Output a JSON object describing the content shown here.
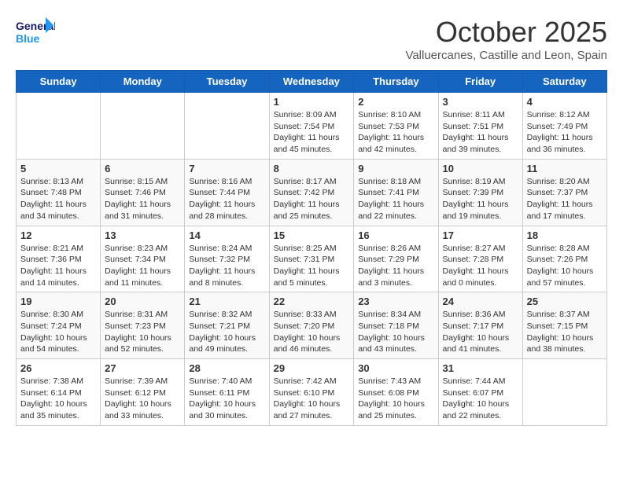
{
  "logo": {
    "line1": "General",
    "line2": "Blue"
  },
  "title": "October 2025",
  "subtitle": "Valluercanes, Castille and Leon, Spain",
  "weekdays": [
    "Sunday",
    "Monday",
    "Tuesday",
    "Wednesday",
    "Thursday",
    "Friday",
    "Saturday"
  ],
  "weeks": [
    [
      {
        "day": "",
        "info": ""
      },
      {
        "day": "",
        "info": ""
      },
      {
        "day": "",
        "info": ""
      },
      {
        "day": "1",
        "info": "Sunrise: 8:09 AM\nSunset: 7:54 PM\nDaylight: 11 hours and 45 minutes."
      },
      {
        "day": "2",
        "info": "Sunrise: 8:10 AM\nSunset: 7:53 PM\nDaylight: 11 hours and 42 minutes."
      },
      {
        "day": "3",
        "info": "Sunrise: 8:11 AM\nSunset: 7:51 PM\nDaylight: 11 hours and 39 minutes."
      },
      {
        "day": "4",
        "info": "Sunrise: 8:12 AM\nSunset: 7:49 PM\nDaylight: 11 hours and 36 minutes."
      }
    ],
    [
      {
        "day": "5",
        "info": "Sunrise: 8:13 AM\nSunset: 7:48 PM\nDaylight: 11 hours and 34 minutes."
      },
      {
        "day": "6",
        "info": "Sunrise: 8:15 AM\nSunset: 7:46 PM\nDaylight: 11 hours and 31 minutes."
      },
      {
        "day": "7",
        "info": "Sunrise: 8:16 AM\nSunset: 7:44 PM\nDaylight: 11 hours and 28 minutes."
      },
      {
        "day": "8",
        "info": "Sunrise: 8:17 AM\nSunset: 7:42 PM\nDaylight: 11 hours and 25 minutes."
      },
      {
        "day": "9",
        "info": "Sunrise: 8:18 AM\nSunset: 7:41 PM\nDaylight: 11 hours and 22 minutes."
      },
      {
        "day": "10",
        "info": "Sunrise: 8:19 AM\nSunset: 7:39 PM\nDaylight: 11 hours and 19 minutes."
      },
      {
        "day": "11",
        "info": "Sunrise: 8:20 AM\nSunset: 7:37 PM\nDaylight: 11 hours and 17 minutes."
      }
    ],
    [
      {
        "day": "12",
        "info": "Sunrise: 8:21 AM\nSunset: 7:36 PM\nDaylight: 11 hours and 14 minutes."
      },
      {
        "day": "13",
        "info": "Sunrise: 8:23 AM\nSunset: 7:34 PM\nDaylight: 11 hours and 11 minutes."
      },
      {
        "day": "14",
        "info": "Sunrise: 8:24 AM\nSunset: 7:32 PM\nDaylight: 11 hours and 8 minutes."
      },
      {
        "day": "15",
        "info": "Sunrise: 8:25 AM\nSunset: 7:31 PM\nDaylight: 11 hours and 5 minutes."
      },
      {
        "day": "16",
        "info": "Sunrise: 8:26 AM\nSunset: 7:29 PM\nDaylight: 11 hours and 3 minutes."
      },
      {
        "day": "17",
        "info": "Sunrise: 8:27 AM\nSunset: 7:28 PM\nDaylight: 11 hours and 0 minutes."
      },
      {
        "day": "18",
        "info": "Sunrise: 8:28 AM\nSunset: 7:26 PM\nDaylight: 10 hours and 57 minutes."
      }
    ],
    [
      {
        "day": "19",
        "info": "Sunrise: 8:30 AM\nSunset: 7:24 PM\nDaylight: 10 hours and 54 minutes."
      },
      {
        "day": "20",
        "info": "Sunrise: 8:31 AM\nSunset: 7:23 PM\nDaylight: 10 hours and 52 minutes."
      },
      {
        "day": "21",
        "info": "Sunrise: 8:32 AM\nSunset: 7:21 PM\nDaylight: 10 hours and 49 minutes."
      },
      {
        "day": "22",
        "info": "Sunrise: 8:33 AM\nSunset: 7:20 PM\nDaylight: 10 hours and 46 minutes."
      },
      {
        "day": "23",
        "info": "Sunrise: 8:34 AM\nSunset: 7:18 PM\nDaylight: 10 hours and 43 minutes."
      },
      {
        "day": "24",
        "info": "Sunrise: 8:36 AM\nSunset: 7:17 PM\nDaylight: 10 hours and 41 minutes."
      },
      {
        "day": "25",
        "info": "Sunrise: 8:37 AM\nSunset: 7:15 PM\nDaylight: 10 hours and 38 minutes."
      }
    ],
    [
      {
        "day": "26",
        "info": "Sunrise: 7:38 AM\nSunset: 6:14 PM\nDaylight: 10 hours and 35 minutes."
      },
      {
        "day": "27",
        "info": "Sunrise: 7:39 AM\nSunset: 6:12 PM\nDaylight: 10 hours and 33 minutes."
      },
      {
        "day": "28",
        "info": "Sunrise: 7:40 AM\nSunset: 6:11 PM\nDaylight: 10 hours and 30 minutes."
      },
      {
        "day": "29",
        "info": "Sunrise: 7:42 AM\nSunset: 6:10 PM\nDaylight: 10 hours and 27 minutes."
      },
      {
        "day": "30",
        "info": "Sunrise: 7:43 AM\nSunset: 6:08 PM\nDaylight: 10 hours and 25 minutes."
      },
      {
        "day": "31",
        "info": "Sunrise: 7:44 AM\nSunset: 6:07 PM\nDaylight: 10 hours and 22 minutes."
      },
      {
        "day": "",
        "info": ""
      }
    ]
  ]
}
